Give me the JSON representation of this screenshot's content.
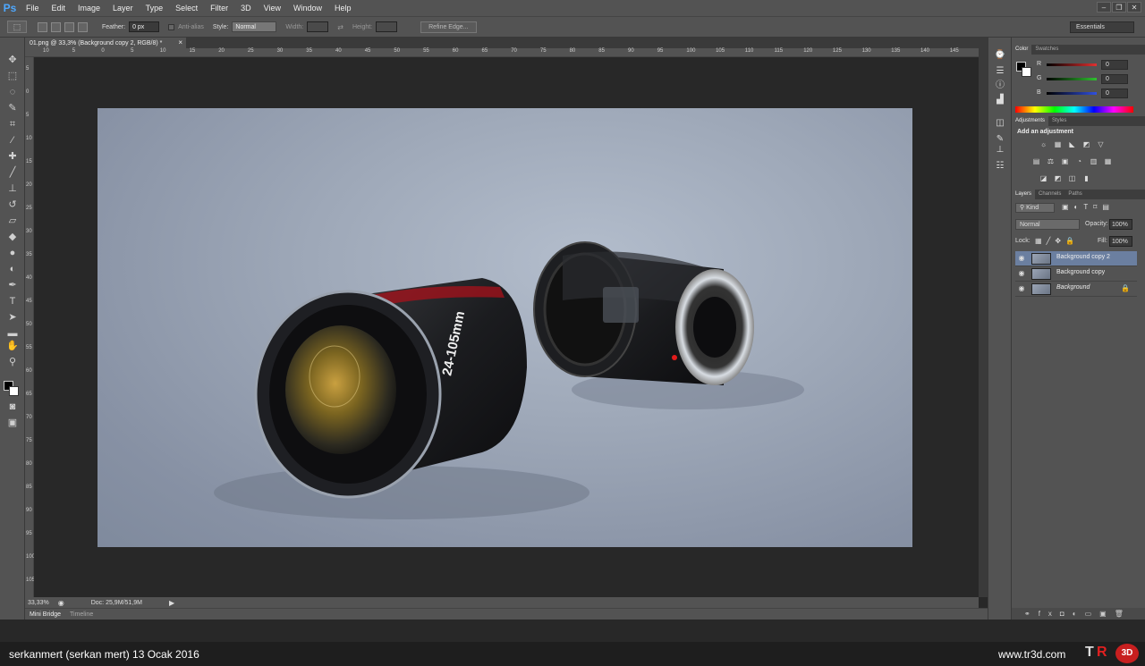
{
  "app": {
    "logo": "Ps"
  },
  "menu": [
    "File",
    "Edit",
    "Image",
    "Layer",
    "Type",
    "Select",
    "Filter",
    "3D",
    "View",
    "Window",
    "Help"
  ],
  "window_controls": {
    "minimize": "–",
    "restore": "❐",
    "close": "✕"
  },
  "options_bar": {
    "feather_label": "Feather:",
    "feather_value": "0 px",
    "antialias_label": "Anti-alias",
    "style_label": "Style:",
    "style_value": "Normal",
    "width_label": "Width:",
    "height_label": "Height:",
    "refine_edge": "Refine Edge...",
    "workspace": "Essentials"
  },
  "document": {
    "tab_title": "01.png @ 33,3% (Background copy 2, RGB/8) *",
    "close": "×"
  },
  "ruler_h": [
    "10",
    "5",
    "0",
    "5",
    "10",
    "15",
    "20",
    "25",
    "30",
    "35",
    "40",
    "45",
    "50",
    "55",
    "60",
    "65",
    "70",
    "75",
    "80",
    "85",
    "90",
    "95",
    "100",
    "105",
    "110",
    "115",
    "120",
    "125",
    "130",
    "135",
    "140",
    "145"
  ],
  "ruler_v": [
    "5",
    "0",
    "5",
    "10",
    "15",
    "20",
    "25",
    "30",
    "35",
    "40",
    "45",
    "50",
    "55",
    "60",
    "65",
    "70",
    "75",
    "80",
    "85",
    "90",
    "95",
    "100",
    "105"
  ],
  "status": {
    "zoom": "33,33%",
    "doc": "Doc: 25,9M/51,9M"
  },
  "bottom_tabs": [
    "Mini Bridge",
    "Timeline"
  ],
  "color_panel": {
    "tabs": [
      "Color",
      "Swatches"
    ],
    "channels": [
      {
        "label": "R",
        "value": "0",
        "color": "#e03030"
      },
      {
        "label": "G",
        "value": "0",
        "color": "#30c030"
      },
      {
        "label": "B",
        "value": "0",
        "color": "#3050e0"
      }
    ]
  },
  "adjustments_panel": {
    "tabs": [
      "Adjustments",
      "Styles"
    ],
    "title": "Add an adjustment"
  },
  "layers_panel": {
    "tabs": [
      "Layers",
      "Channels",
      "Paths"
    ],
    "filter": "Kind",
    "blend_mode": "Normal",
    "opacity_label": "Opacity:",
    "opacity": "100%",
    "lock_label": "Lock:",
    "fill_label": "Fill:",
    "fill": "100%",
    "layers": [
      {
        "name": "Background copy 2",
        "selected": true
      },
      {
        "name": "Background copy",
        "selected": false
      },
      {
        "name": "Background",
        "selected": false,
        "locked": true
      }
    ]
  },
  "image_text": {
    "lens1_mark": "24-105mm"
  },
  "footer": {
    "author": "serkanmert (serkan mert)  13 Ocak 2016",
    "site": "www.tr3d.com",
    "logo_t": "T",
    "logo_r": "R",
    "logo_3d": "3D"
  },
  "colors": {
    "ui_panel": "#535353",
    "canvas_bg": "#282828",
    "accent_blue": "#4ea8ff",
    "selected_layer": "#6b7fa0"
  }
}
